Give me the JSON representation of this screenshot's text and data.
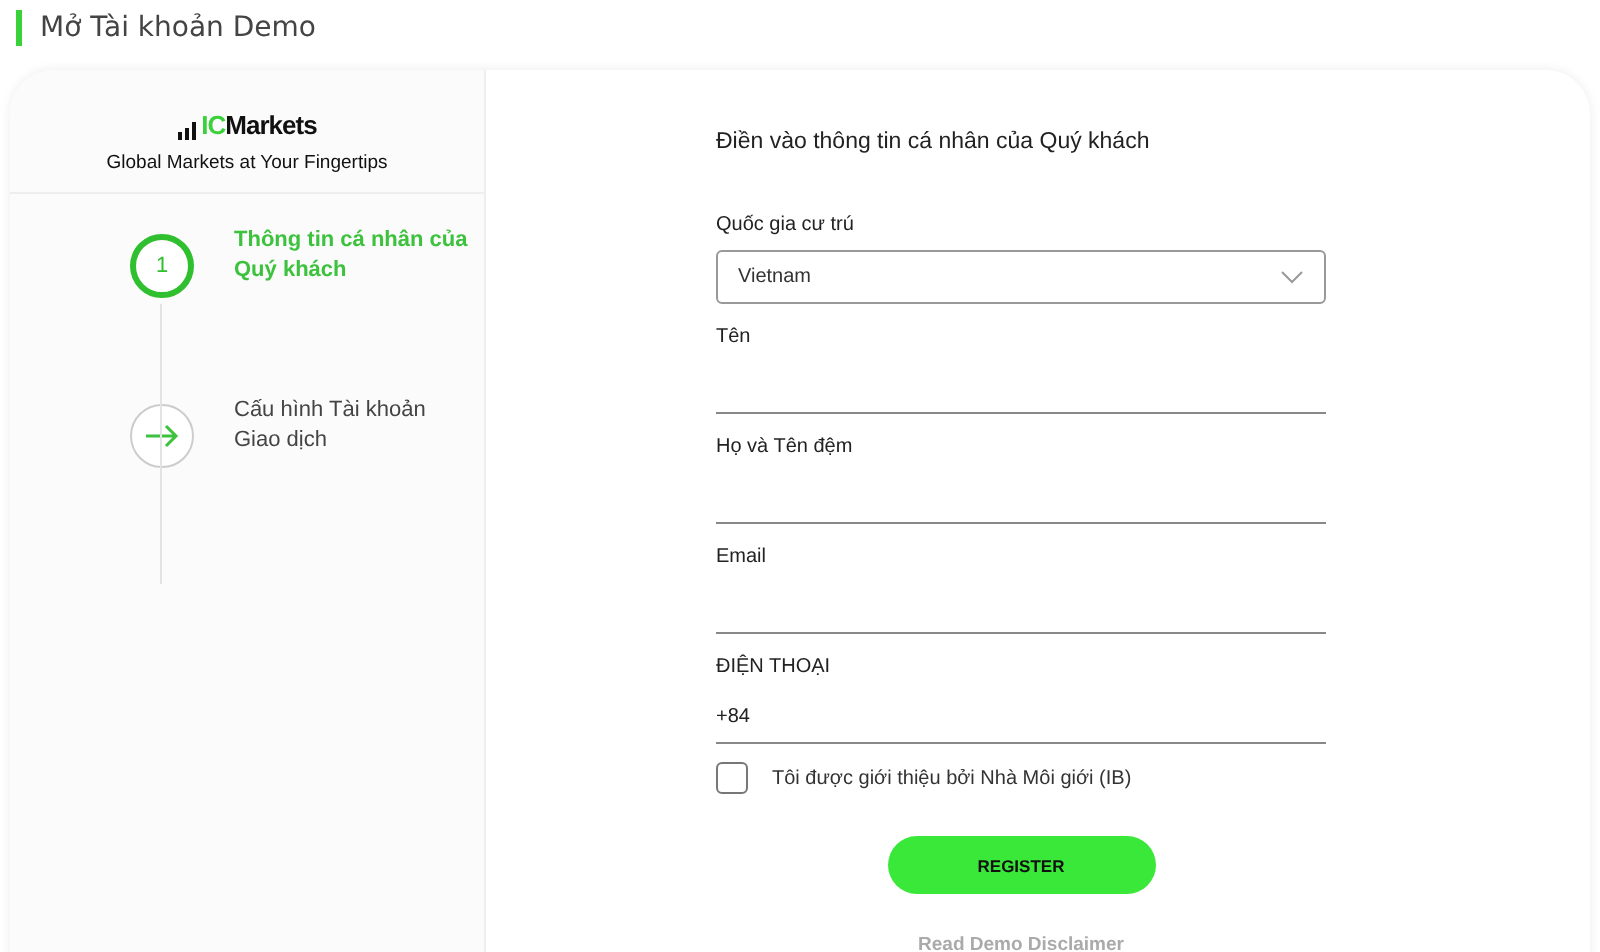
{
  "header": {
    "title": "Mở Tài khoản Demo"
  },
  "brand": {
    "logo_prefix": "IC",
    "logo_suffix": "Markets",
    "tagline": "Global Markets at Your Fingertips"
  },
  "steps": [
    {
      "number": "1",
      "label": "Thông tin cá nhân của Quý khách",
      "active": true
    },
    {
      "label": "Cấu hình Tài khoản Giao dịch",
      "active": false
    }
  ],
  "form": {
    "heading": "Điền vào thông tin cá nhân của Quý khách",
    "fields": [
      {
        "kind": "select",
        "label": "Quốc gia cư trú",
        "value": "Vietnam"
      },
      {
        "kind": "text",
        "label": "Tên"
      },
      {
        "kind": "text",
        "label": "Họ và Tên đệm"
      },
      {
        "kind": "text",
        "label": "Email"
      },
      {
        "kind": "text",
        "label": "ĐIỆN THOẠI",
        "value": "+84"
      }
    ],
    "ib_checkbox": {
      "label": "Tôi được giới thiệu bởi Nhà Môi giới (IB)",
      "checked": false
    },
    "register_button": "REGISTER",
    "disclaimer_link": "Read Demo Disclaimer"
  }
}
